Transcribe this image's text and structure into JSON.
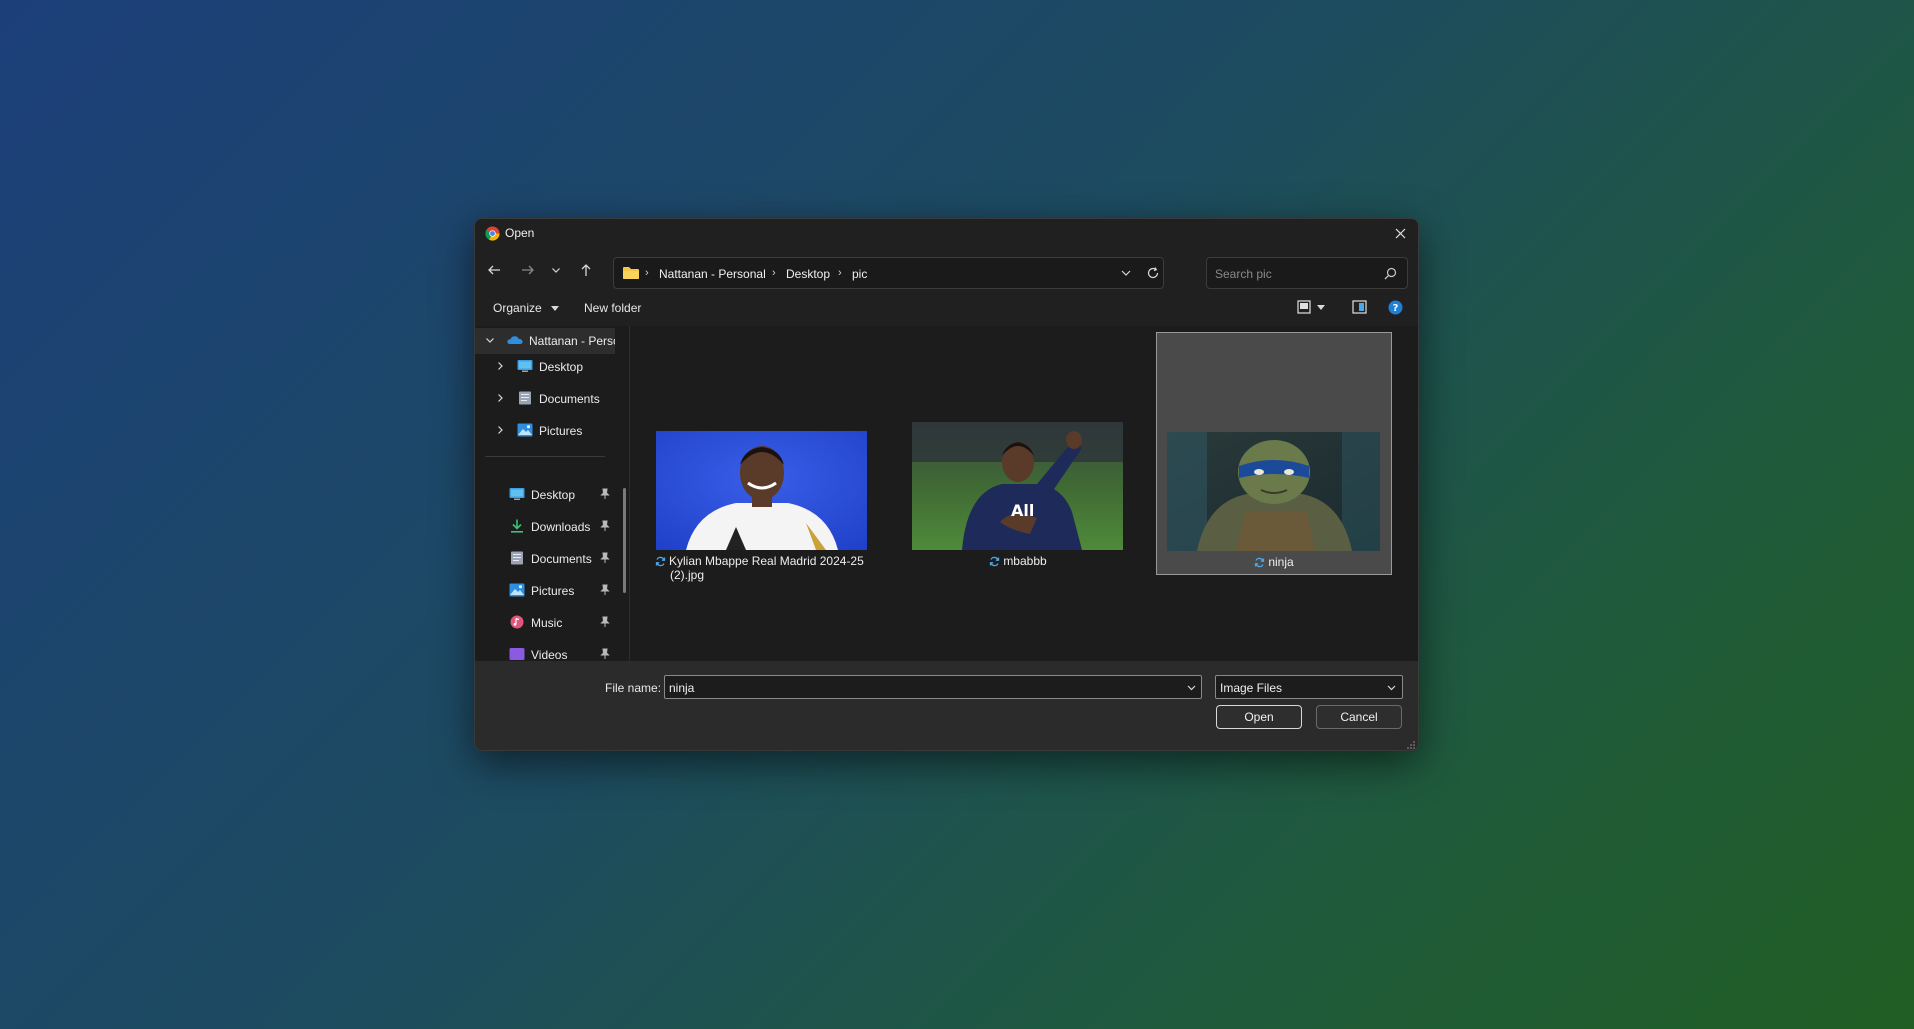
{
  "window": {
    "title": "Open",
    "app_icon": "chrome-icon"
  },
  "nav": {
    "back_icon": "back-arrow-icon",
    "forward_icon": "forward-arrow-icon",
    "recent_icon": "chevron-down-icon",
    "up_icon": "up-arrow-icon",
    "breadcrumbs": [
      "Nattanan - Personal",
      "Desktop",
      "pic"
    ],
    "search_placeholder": "Search pic"
  },
  "toolbar": {
    "organize_label": "Organize",
    "new_folder_label": "New folder"
  },
  "sidebar": {
    "items": [
      {
        "label": "Nattanan - Personal",
        "icon": "onedrive-cloud-icon",
        "expanded": true
      },
      {
        "label": "Desktop",
        "icon": "desktop-icon"
      },
      {
        "label": "Documents",
        "icon": "documents-icon"
      },
      {
        "label": "Pictures",
        "icon": "pictures-icon"
      }
    ],
    "quick_access": [
      {
        "label": "Desktop",
        "icon": "desktop-icon",
        "pinned": true
      },
      {
        "label": "Downloads",
        "icon": "downloads-icon",
        "pinned": true
      },
      {
        "label": "Documents",
        "icon": "documents-icon",
        "pinned": true
      },
      {
        "label": "Pictures",
        "icon": "pictures-icon",
        "pinned": true
      },
      {
        "label": "Music",
        "icon": "music-icon",
        "pinned": true
      },
      {
        "label": "Videos",
        "icon": "videos-icon",
        "pinned": true
      }
    ]
  },
  "files": [
    {
      "name": "Kylian Mbappe Real Madrid 2024-25 (2).jpg",
      "name_line1": "Kylian Mbappe Real Madrid 2024-25",
      "name_line2": "(2).jpg",
      "selected": false
    },
    {
      "name": "mbabbb",
      "selected": false
    },
    {
      "name": "ninja",
      "selected": true
    }
  ],
  "footer": {
    "file_name_label": "File name:",
    "file_name_value": "ninja",
    "filter_value": "Image Files",
    "open_label": "Open",
    "cancel_label": "Cancel"
  },
  "colors": {
    "accent": "#4aa8e8",
    "dialog_bg": "#1c1c1c",
    "footer_bg": "#2b2b2b",
    "selected_tile": "#4a4a4a"
  }
}
